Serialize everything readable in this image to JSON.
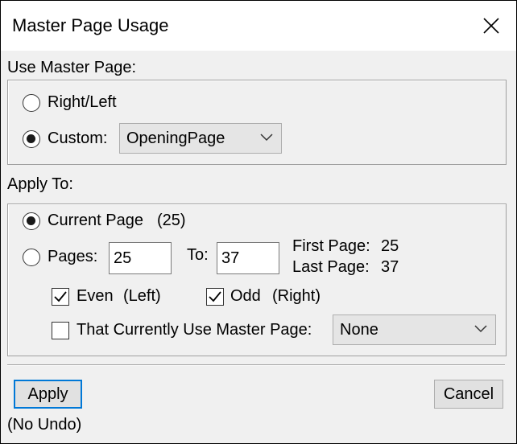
{
  "window": {
    "title": "Master Page Usage"
  },
  "use_master_page": {
    "label": "Use Master Page:",
    "right_left_label": "Right/Left",
    "custom_label": "Custom:",
    "custom_selected": "OpeningPage",
    "selected_option": "custom"
  },
  "apply_to": {
    "label": "Apply To:",
    "current_page_label": "Current Page",
    "current_page_value": "(25)",
    "pages_label": "Pages:",
    "pages_from": "25",
    "to_label": "To:",
    "pages_to": "37",
    "first_page_label": "First Page:",
    "first_page_value": "25",
    "last_page_label": "Last Page:",
    "last_page_value": "37",
    "selected_option": "current_page",
    "even_label": "Even",
    "even_sub": "(Left)",
    "even_checked": true,
    "odd_label": "Odd",
    "odd_sub": "(Right)",
    "odd_checked": true,
    "master_filter_label": "That Currently Use Master Page:",
    "master_filter_checked": false,
    "master_filter_selected": "None"
  },
  "footer": {
    "apply_label": "Apply",
    "cancel_label": "Cancel",
    "note": "(No Undo)"
  },
  "icons": {
    "close": "close-icon",
    "dropdown": "chevron-down-icon",
    "checkmark": "checkmark-icon"
  },
  "colors": {
    "dialog_bg": "#f0f0f0",
    "title_bg": "#ffffff",
    "default_button_border": "#0078d7"
  }
}
